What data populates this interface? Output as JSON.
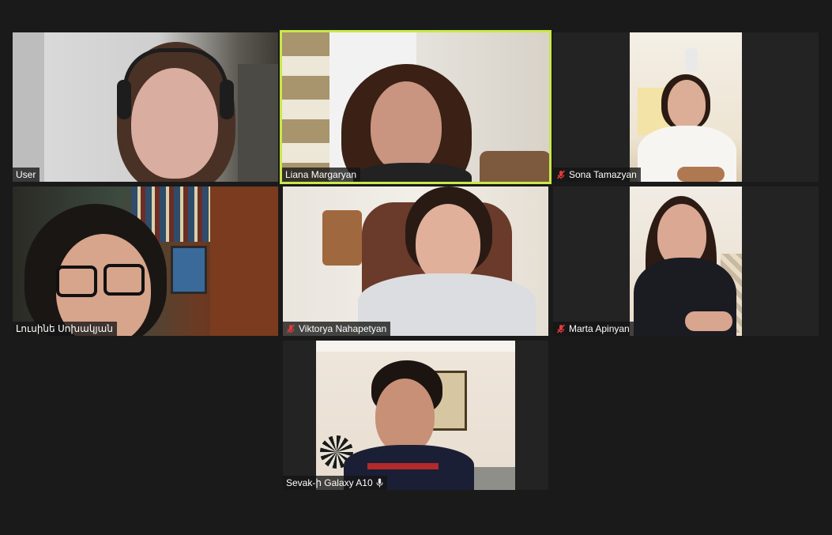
{
  "colors": {
    "background": "#1a1a1a",
    "tile_background": "#232323",
    "active_speaker_border": "#c8e84a",
    "muted_icon": "#e03a3a"
  },
  "participants": [
    {
      "name": "User",
      "muted": false,
      "active_speaker": false
    },
    {
      "name": "Liana Margaryan",
      "muted": false,
      "active_speaker": true
    },
    {
      "name": "Sona Tamazyan",
      "muted": true,
      "active_speaker": false
    },
    {
      "name": "Լուսինե Սոխակյան",
      "muted": false,
      "active_speaker": false
    },
    {
      "name": "Viktorya Nahapetyan",
      "muted": true,
      "active_speaker": false
    },
    {
      "name": "Marta Apinyan",
      "muted": true,
      "active_speaker": false
    },
    {
      "name": "Sevak-ի Galaxy A10",
      "muted": false,
      "active_speaker": false,
      "icon": "microphone-icon"
    }
  ]
}
